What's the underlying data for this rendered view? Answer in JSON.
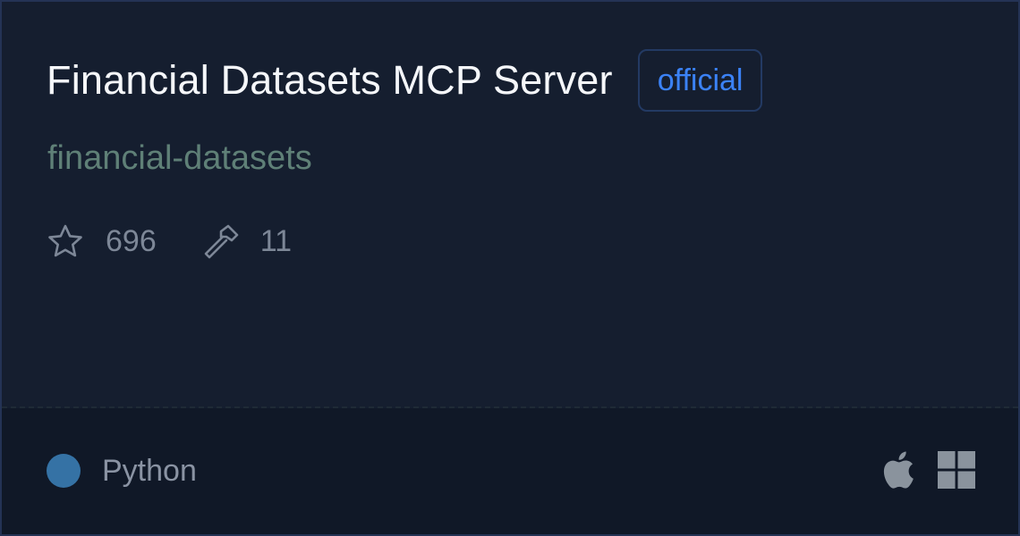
{
  "server": {
    "title": "Financial Datasets MCP Server",
    "badge": "official",
    "owner": "financial-datasets"
  },
  "stats": {
    "stars": "696",
    "tools": "11",
    "star_icon": "star-icon",
    "tools_icon": "hammer-icon"
  },
  "footer": {
    "language": "Python",
    "language_color": "#3572a5",
    "platforms": [
      "apple-icon",
      "windows-icon"
    ]
  },
  "colors": {
    "badge_text": "#3b82f6",
    "owner_text": "#5f8077",
    "card_bg": "#151e2f",
    "footer_bg": "#101827"
  }
}
